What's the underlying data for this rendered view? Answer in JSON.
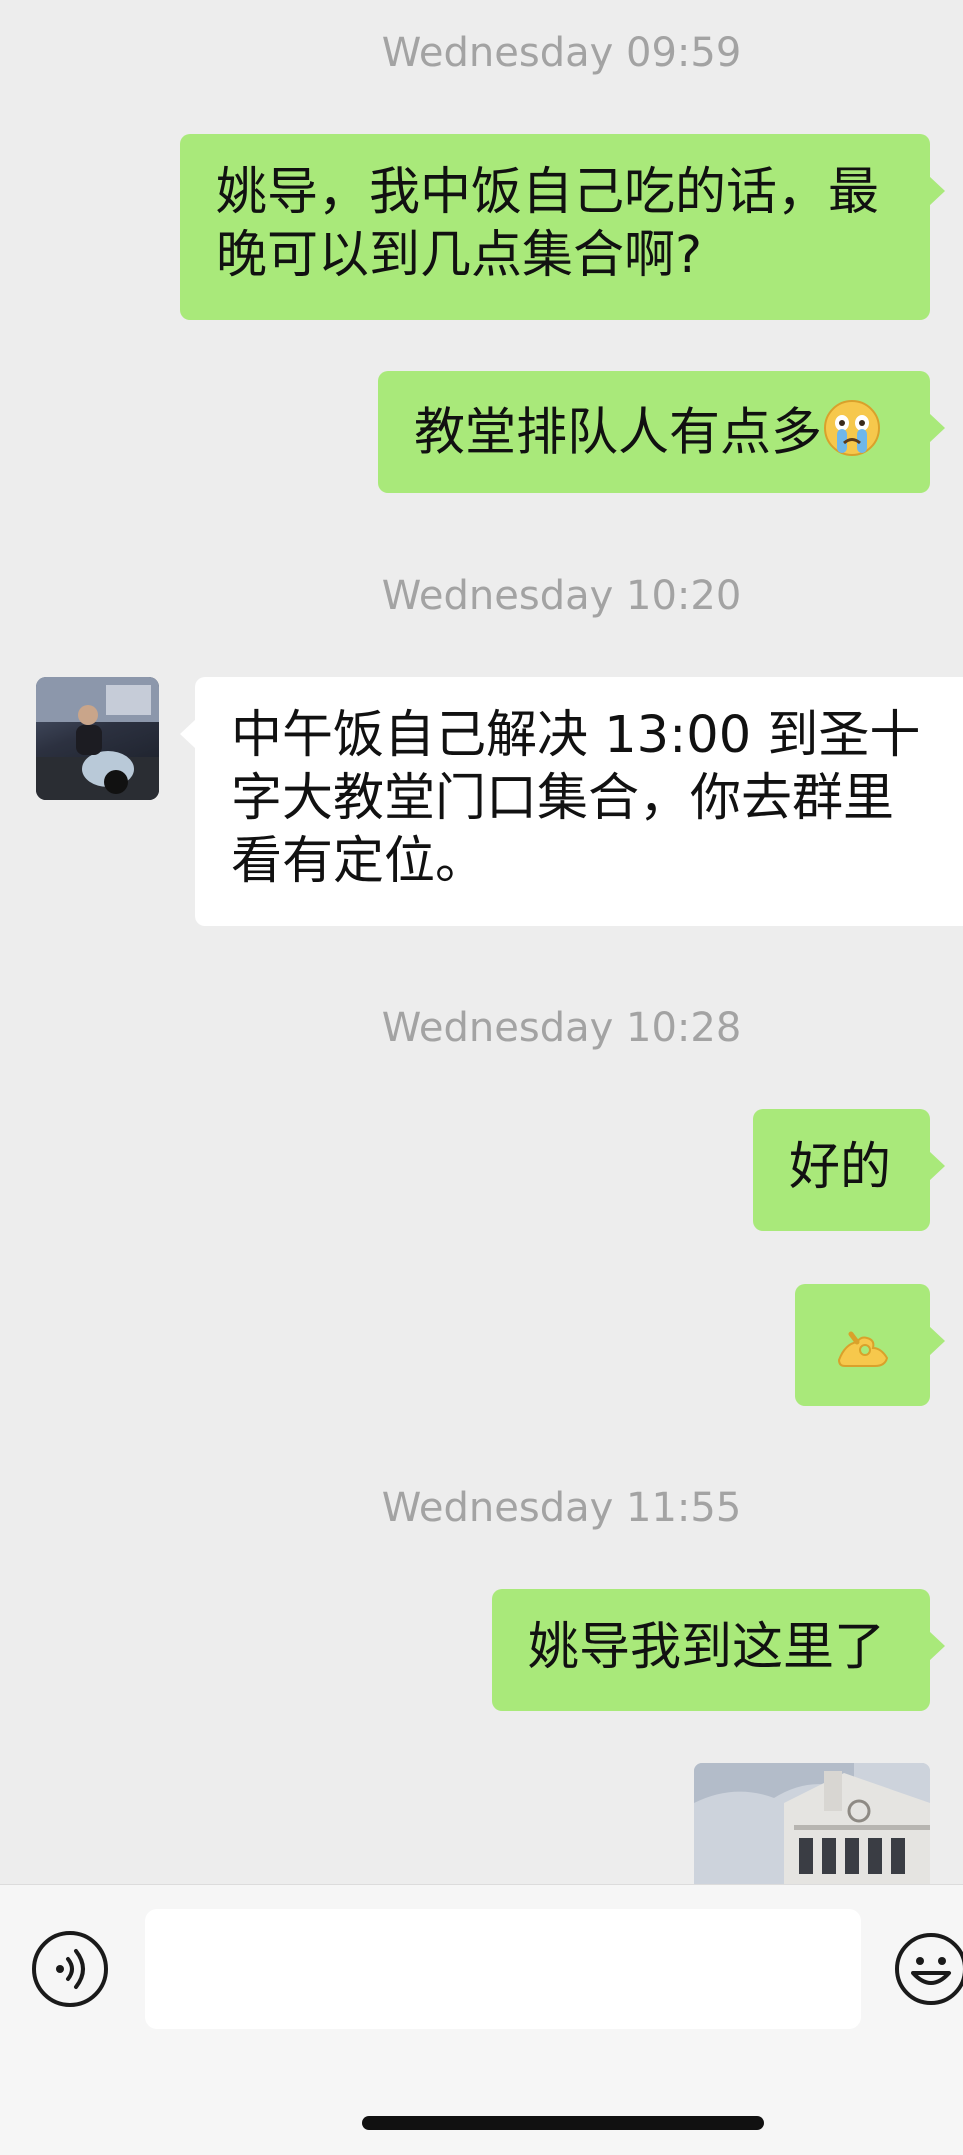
{
  "chat": {
    "ts1": "Wednesday 09:59",
    "msg1": "姚导，我中饭自己吃的话，最晚可以到几点集合啊?",
    "msg2": "教堂排队人有点多",
    "msg2_emoji": "crying-face-emoji",
    "ts2": "Wednesday 10:20",
    "msg3": "中午饭自己解决 13:00 到圣十字大教堂门口集合，你去群里看有定位。",
    "ts3": "Wednesday 10:28",
    "msg4": "好的",
    "msg5_emoji": "ok-hand-emoji",
    "ts4": "Wednesday 11:55",
    "msg6": "姚导我到这里了"
  },
  "input": {
    "value": "",
    "placeholder": ""
  },
  "colors": {
    "background": "#ededed",
    "my_bubble": "#a9e97a",
    "other_bubble": "#ffffff",
    "timestamp": "#a3a3a3"
  },
  "icons": {
    "voice": "voice-icon",
    "emoji": "emoji-icon"
  }
}
